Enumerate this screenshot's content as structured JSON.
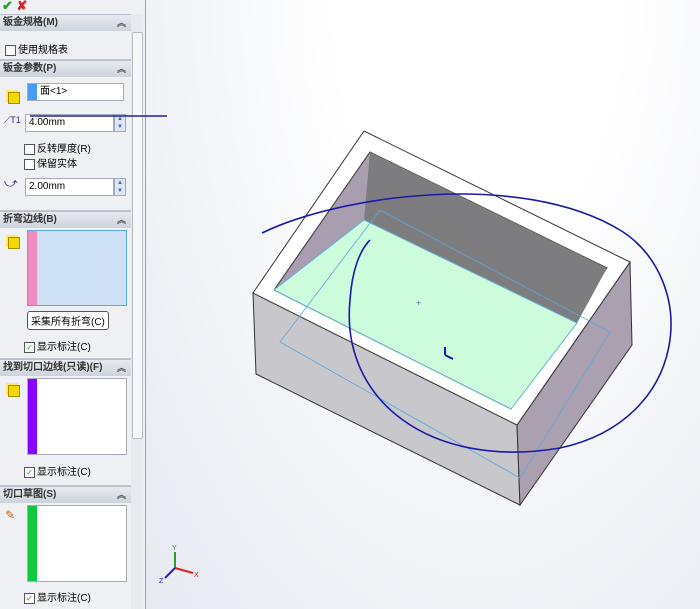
{
  "toolbar": {
    "ok_icon": "✔",
    "cancel_icon": "✘"
  },
  "sections": {
    "gauge": {
      "title": "钣金规格(M)",
      "use_gauge_table": "使用规格表"
    },
    "params": {
      "title": "钣金参数(P)",
      "face": "面<1>",
      "thickness": "4.00mm",
      "reverse": "反转厚度(R)",
      "keep_body": "保留实体",
      "radius": "2.00mm"
    },
    "bend_edges": {
      "title": "折弯边线(B)",
      "collect_button": "采集所有折弯(C)",
      "show_callouts": "显示标注(C)",
      "color": "#f08ac0"
    },
    "rip_edges": {
      "title": "找到切口边线(只读)(F)",
      "show_callouts": "显示标注(C)",
      "color": "#8800ff"
    },
    "rip_sketch": {
      "title": "切口草图(S)",
      "show_callouts": "显示标注(C)",
      "color": "#10c840"
    }
  },
  "collapse_icon": "︽"
}
